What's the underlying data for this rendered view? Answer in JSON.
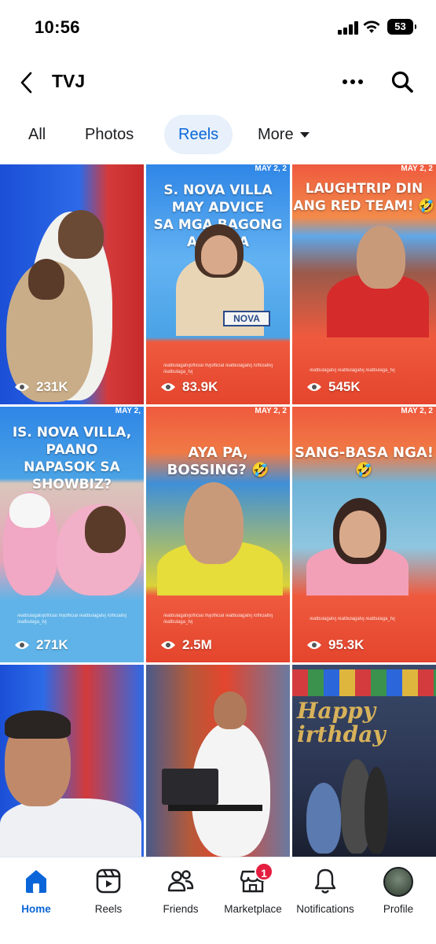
{
  "status_bar": {
    "time": "10:56",
    "battery": "53"
  },
  "header": {
    "title": "TVJ"
  },
  "tabs": [
    {
      "label": "All"
    },
    {
      "label": "Photos"
    },
    {
      "label": "Reels"
    },
    {
      "label": "More"
    }
  ],
  "active_tab": "Reels",
  "reels": [
    {
      "caption": "",
      "date": "",
      "views": "231K"
    },
    {
      "caption": "S. NOVA VILLA MAY ADVICE\nSA MGA BAGONG ARTISTA",
      "date": "MAY 2, 2",
      "name_tag": "NOVA",
      "handles": "/eatbulagatvjofficial  /tvjofficial  /eatbulagatvj  /officialtvj  /eatbulaga_tvj",
      "views": "83.9K"
    },
    {
      "caption": "LAUGHTRIP DIN\nANG RED TEAM! 🤣",
      "date": "MAY 2, 2",
      "handles": "/eatbulagatvj  /eatbulagatvj  /eatbulaga_tvj",
      "views": "545K"
    },
    {
      "caption": "IS. NOVA VILLA, PAANO\nNAPASOK SA SHOWBIZ?",
      "date": "MAY 2,",
      "handles": "/eatbulagatvjofficial  /tvjofficial  /eatbulagatvj  /officialtvj  /eatbulaga_tvj",
      "views": "271K"
    },
    {
      "caption": "AYA PA, BOSSING? 🤣",
      "date": "MAY 2, 2",
      "handles": "/eatbulagatvjofficial  /tvjofficial  /eatbulagatvj  /officialtvj  /eatbulaga_tvj",
      "views": "2.5M"
    },
    {
      "caption": "SANG-BASA NGA! 🤣",
      "date": "MAY 2, 2",
      "handles": "/eatbulagatvj  /eatbulagatvj  /eatbulaga_tvj",
      "views": "95.3K"
    },
    {
      "caption": "",
      "date": "",
      "views": ""
    },
    {
      "caption": "",
      "date": "",
      "views": ""
    },
    {
      "caption": "",
      "date": "",
      "banner": "Happy\nirthday",
      "views": ""
    }
  ],
  "bottom_nav": [
    {
      "label": "Home",
      "icon": "home-icon"
    },
    {
      "label": "Reels",
      "icon": "reels-icon"
    },
    {
      "label": "Friends",
      "icon": "friends-icon"
    },
    {
      "label": "Marketplace",
      "icon": "marketplace-icon",
      "badge": "1"
    },
    {
      "label": "Notifications",
      "icon": "bell-icon"
    },
    {
      "label": "Profile",
      "icon": "avatar"
    }
  ],
  "colors": {
    "accent": "#0a66d8",
    "badge": "#e41e3f",
    "tab_active_bg": "#e7f0fb"
  }
}
